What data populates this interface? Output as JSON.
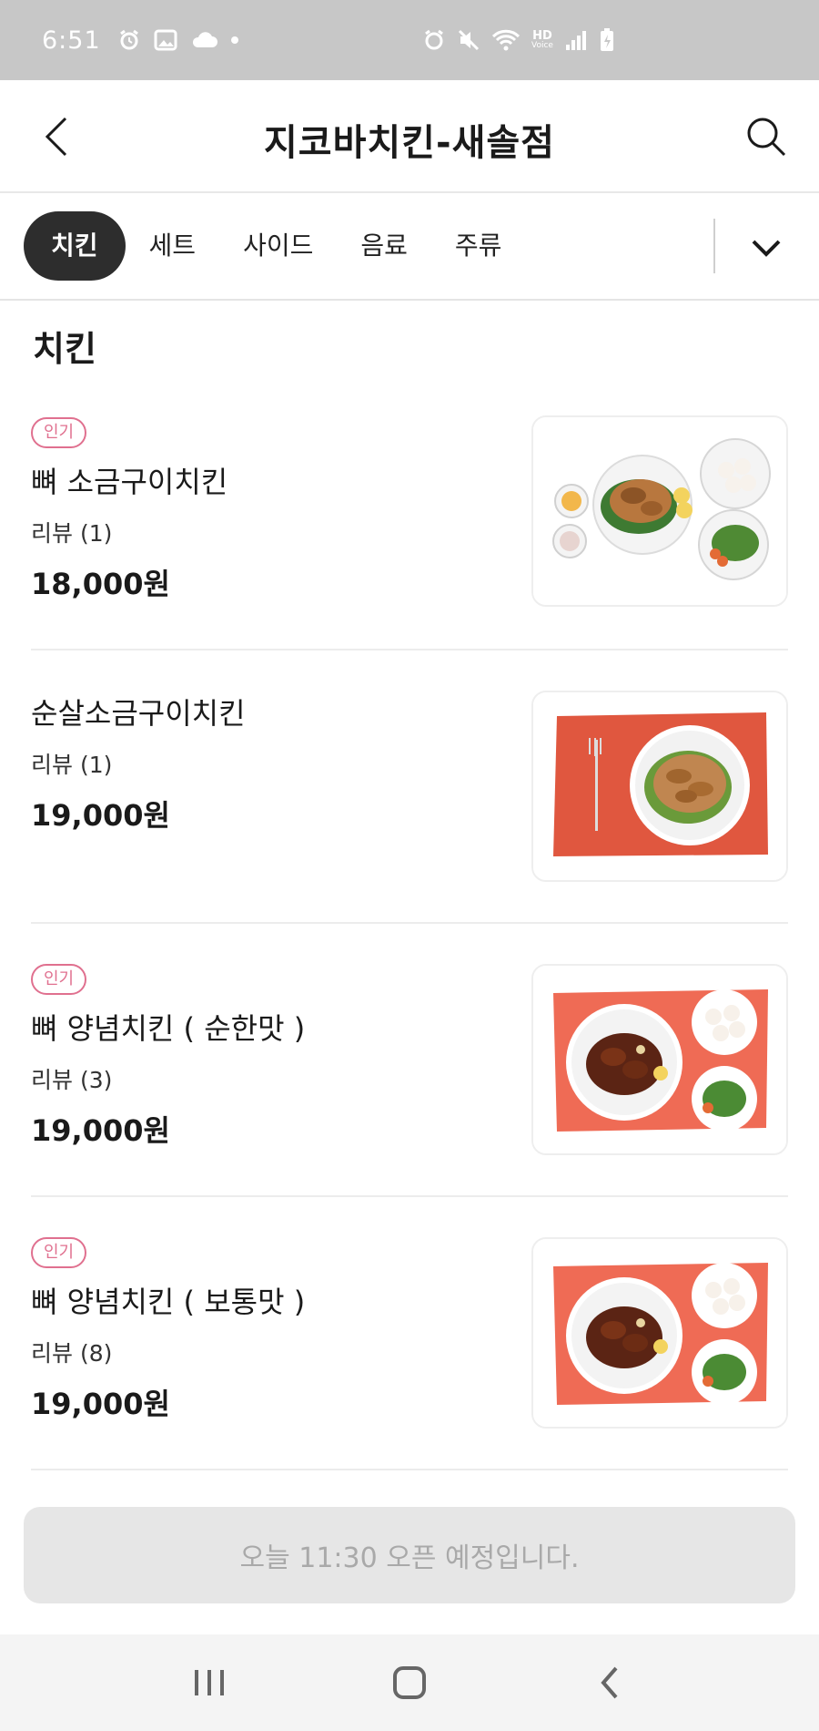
{
  "status_bar": {
    "time": "6:51",
    "left_icons": [
      "alarm-icon",
      "gallery-icon",
      "cloud-icon",
      "dot-icon"
    ],
    "right_icons": [
      "alarm-icon",
      "mute-icon",
      "wifi-icon",
      "hd-voice-icon",
      "signal-icon",
      "battery-icon"
    ],
    "hd_label": "HD",
    "voice_label": "Voice"
  },
  "header": {
    "title": "지코바치킨-새솔점",
    "back_icon": "back-arrow-icon",
    "search_icon": "search-icon"
  },
  "tabs": [
    {
      "label": "치킨",
      "active": true
    },
    {
      "label": "세트",
      "active": false
    },
    {
      "label": "사이드",
      "active": false
    },
    {
      "label": "음료",
      "active": false
    },
    {
      "label": "주류",
      "active": false
    }
  ],
  "section": {
    "title": "치킨"
  },
  "menu": [
    {
      "badge": "인기",
      "name": "뼈 소금구이치킨",
      "review": "리뷰 (1)",
      "price": "18,000원",
      "image": "salt-grilled-chicken-platter"
    },
    {
      "badge": "",
      "name": "순살소금구이치킨",
      "review": "리뷰 (1)",
      "price": "19,000원",
      "image": "boneless-salt-chicken-plate"
    },
    {
      "badge": "인기",
      "name": "뼈 양념치킨 ( 순한맛 )",
      "review": "리뷰 (3)",
      "price": "19,000원",
      "image": "seasoned-chicken-platter"
    },
    {
      "badge": "인기",
      "name": "뼈 양념치킨 ( 보통맛 )",
      "review": "리뷰 (8)",
      "price": "19,000원",
      "image": "seasoned-chicken-platter"
    }
  ],
  "notice": {
    "text": "오늘 11:30 오픈 예정입니다."
  },
  "nav": {
    "items": [
      "recent-apps-icon",
      "home-icon",
      "back-icon"
    ]
  },
  "colors": {
    "badge": "#e0708f",
    "active_tab": "#2d2d2d",
    "status_bar": "#c7c7c7",
    "notice_bg": "#e6e6e6"
  }
}
